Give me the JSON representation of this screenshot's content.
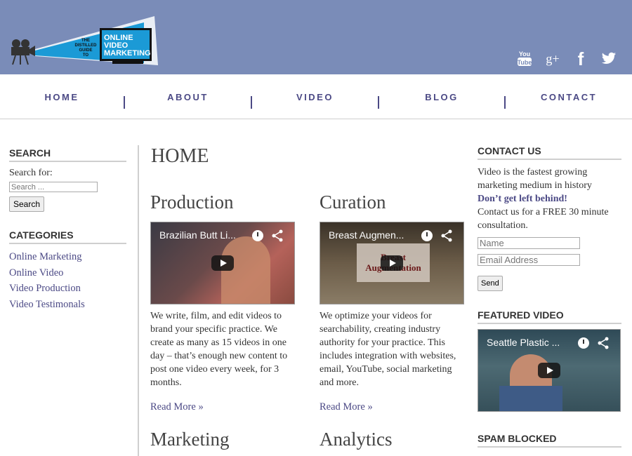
{
  "header": {
    "logo": {
      "line1": "THE",
      "line2": "DISTILLED",
      "line3": "GUIDE",
      "line4": "TO",
      "screen_line1": "ONLINE",
      "screen_line2": "VIDEO",
      "screen_line3": "MARKETING"
    },
    "social": {
      "youtube_top": "You",
      "youtube_bottom": "Tube",
      "googleplus": "g+",
      "facebook": "f"
    }
  },
  "nav": {
    "items": [
      {
        "label": "HOME"
      },
      {
        "label": "ABOUT"
      },
      {
        "label": "VIDEO"
      },
      {
        "label": "BLOG"
      },
      {
        "label": "CONTACT"
      }
    ]
  },
  "left_sidebar": {
    "search_title": "SEARCH",
    "search_label": "Search for:",
    "search_placeholder": "Search ...",
    "search_button": "Search",
    "categories_title": "CATEGORIES",
    "categories": [
      "Online Marketing",
      "Online Video",
      "Video Production",
      "Video Testimonals"
    ]
  },
  "main": {
    "page_title": "HOME",
    "columns": [
      {
        "heading": "Production",
        "video_title": "Brazilian Butt Li...",
        "text": "We write, film, and edit videos to brand your specific practice. We create as many as 15 videos in one day – that’s enough new content to post one video every week, for 3 months.",
        "read_more": "Read More »"
      },
      {
        "heading": "Curation",
        "video_title": "Breast Augmen...",
        "video_overlay": "Breast Augmentation",
        "text": "We optimize your videos for searchability, creating industry authority for your practice. This includes integration with websites, email, YouTube, social marketing and more.",
        "read_more": "Read More »"
      }
    ],
    "row2_headings": [
      "Marketing",
      "Analytics"
    ]
  },
  "right_sidebar": {
    "contact_title": "CONTACT US",
    "contact_text": "Video is the fastest growing marketing medium in history",
    "contact_emph": "Don’t get left behind!",
    "contact_text2": "Contact us for a FREE 30 minute consultation.",
    "name_placeholder": "Name",
    "email_placeholder": "Email Address",
    "send_button": "Send",
    "featured_title": "FEATURED VIDEO",
    "featured_video_title": "Seattle Plastic ...",
    "spam_title": "SPAM BLOCKED"
  },
  "colors": {
    "header_bg": "#7a8cb8",
    "accent": "#4b4985",
    "logo_blue": "#1b9ad6"
  }
}
